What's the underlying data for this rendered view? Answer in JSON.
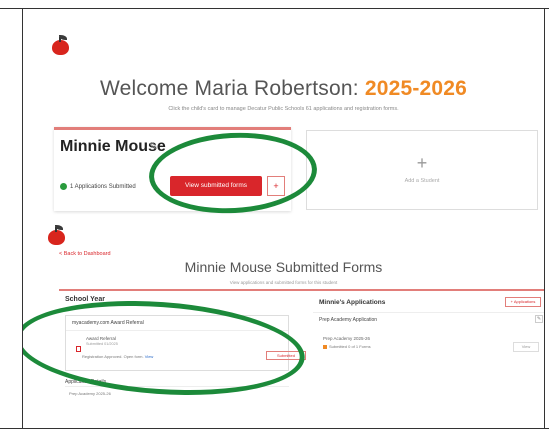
{
  "dashboard": {
    "welcome_prefix": "Welcome Maria Robertson:",
    "school_year": "2025-2026",
    "subtitle": "Click the child's card to manage Decatur Public Schools 61 applications and registration forms.",
    "student": {
      "name": "Minnie Mouse",
      "apps_submitted": "1 Applications Submitted",
      "view_button": "View submitted forms",
      "plus": "+"
    },
    "add_student": {
      "plus": "+",
      "label": "Add a Student"
    }
  },
  "submitted_forms": {
    "back_link": "< Back to Dashboard",
    "title": "Minnie Mouse Submitted Forms",
    "subtitle": "View applications and submitted forms for this student",
    "left_panel": {
      "heading": "School Year",
      "card_title": "myacademy.com Award Referral",
      "form_name": "Award Referral",
      "form_date": "Submitted 01/2025",
      "form_note": "Registration Approved. Open form. ",
      "form_link": "View",
      "status": "Submitted",
      "lower_section": "Application Details",
      "lower_item": "Prep Academy 2025-26"
    },
    "right_panel": {
      "heading": "Minnie's Applications",
      "button": "+ Applications",
      "app_name": "Prep Academy Application",
      "edit": "✎",
      "item": "Prep Academy 2025-26",
      "status": "Submitted 0 of 1 Forms",
      "view": "View"
    }
  },
  "icons": {
    "logo": "apple-logo-icon",
    "check": "check-circle-icon",
    "edit": "pencil-icon",
    "doc": "document-icon"
  },
  "colors": {
    "brand_red": "#d9262b",
    "accent_orange": "#f08a24",
    "annotation_green": "#1c8a3a"
  }
}
